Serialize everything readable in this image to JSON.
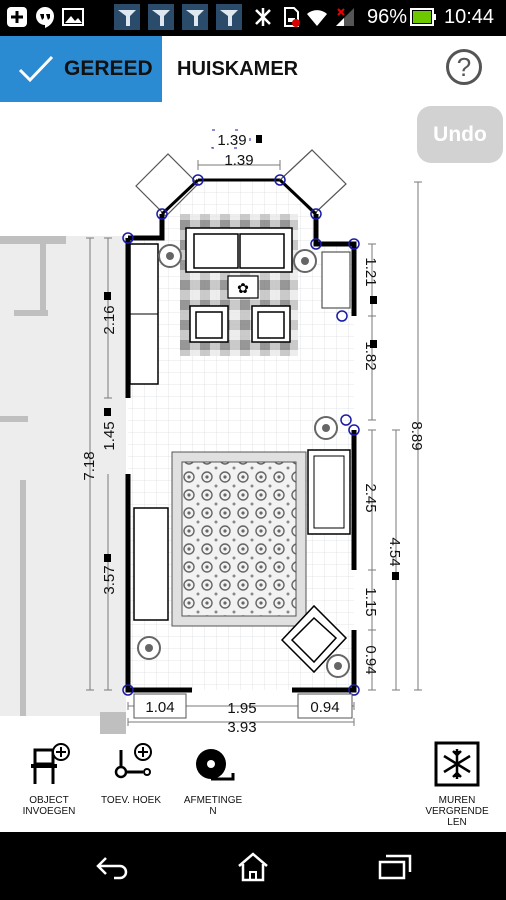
{
  "status_bar": {
    "battery": "96%",
    "time": "10:44",
    "icons": [
      "add-icon",
      "hangouts-icon",
      "image-icon",
      "app-icon",
      "app-icon",
      "app-icon",
      "app-icon",
      "bluetooth-icon",
      "sd-icon",
      "wifi-icon",
      "signal-icon",
      "battery-icon"
    ]
  },
  "header": {
    "done_label": "GEREED",
    "room_title": "HUISKAMER",
    "help_label": "?"
  },
  "undo_label": "Undo",
  "dimensions": {
    "top_wall_a": "1.39",
    "top_wall_b": "1.39",
    "left_top": "2.16",
    "left_mid": "1.45",
    "left_total": "7.18",
    "left_bottom": "3.57",
    "right_top": "1.21",
    "right_mid": "1.82",
    "right_total": "8.89",
    "right_lower_a": "2.45",
    "right_lower_total": "4.54",
    "right_lower_b": "1.15",
    "right_lower_c": "0.94",
    "bottom_left": "1.04",
    "bottom_mid": "1.95",
    "bottom_right": "0.94",
    "bottom_total": "3.93"
  },
  "toolbar": {
    "object_label_1": "OBJECT",
    "object_label_2": "INVOEGEN",
    "corner_label": "TOEV. HOEK",
    "measure_label_1": "AFMETINGE",
    "measure_label_2": "N",
    "lock_label_1": "MUREN",
    "lock_label_2": "VERGRENDE",
    "lock_label_3": "LEN"
  },
  "colors": {
    "accent": "#2a8ad2",
    "undo_bg": "#d2d2d2",
    "wall": "#000000",
    "handle": "#1a1aa8",
    "dim_line": "#7a7a7a"
  }
}
